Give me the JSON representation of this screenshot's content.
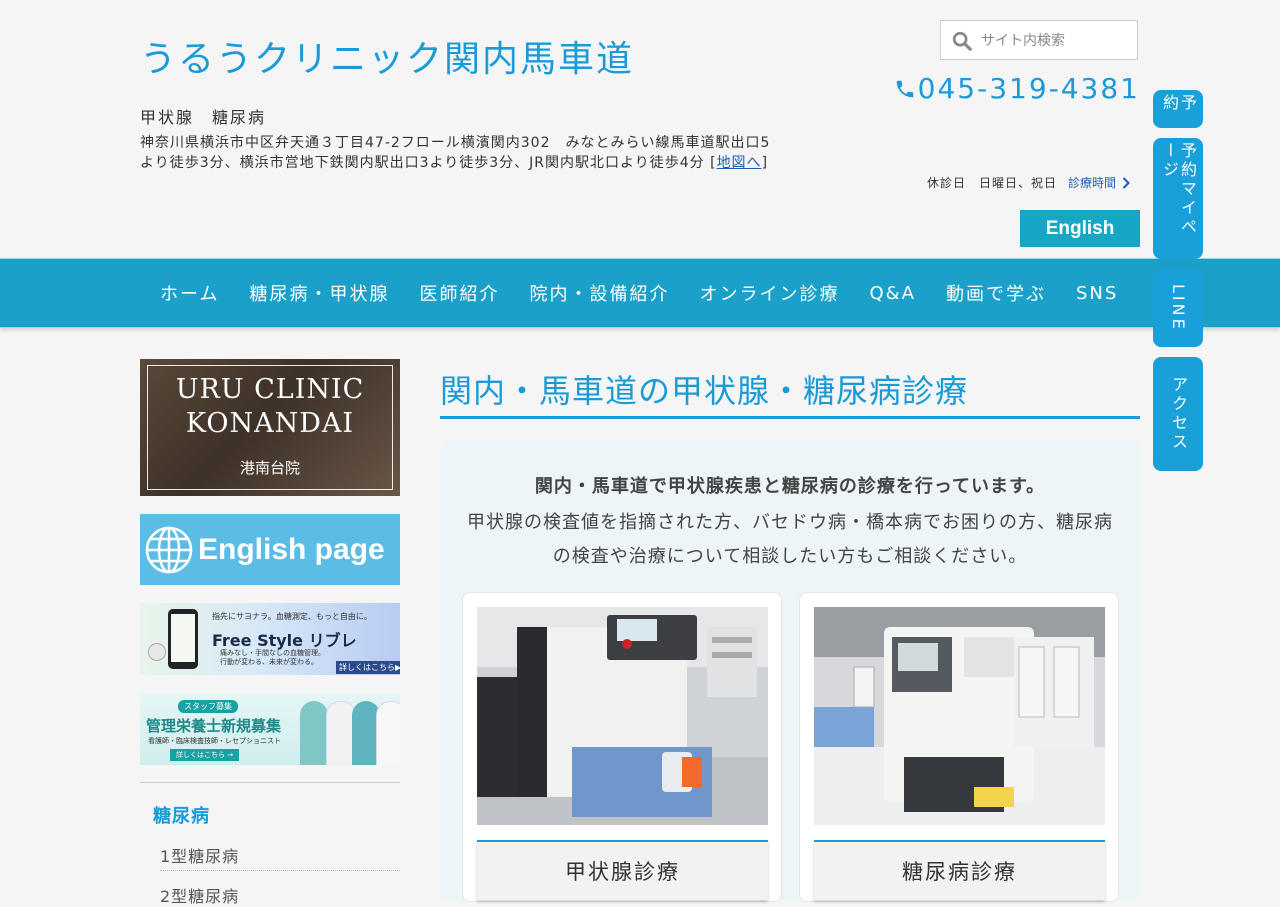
{
  "header": {
    "site_title": "うるうクリニック関内馬車道",
    "tagline": "甲状腺　糖尿病",
    "address": "神奈川県横浜市中区弁天通３丁目47-2フロール横濱関内302　みなとみらい線馬車道駅出口5より徒歩3分、横浜市営地下鉄関内駅出口3より徒歩3分、JR関内駅北口より徒歩4分 [",
    "map_link": "地図へ",
    "address_close": "]",
    "search_placeholder": "サイト内検索",
    "phone": "045-319-4381",
    "closed_days": "休診日　日曜日、祝日",
    "hours_link": "診療時間",
    "english_button": "English"
  },
  "nav": {
    "items": [
      "ホーム",
      "糖尿病・甲状腺",
      "医師紹介",
      "院内・設備紹介",
      "オンライン診療",
      "Q&A",
      "動画で学ぶ",
      "SNS"
    ]
  },
  "float_buttons": [
    "予約",
    "予約マイページ",
    "LINE",
    "アクセス"
  ],
  "sidebar": {
    "banner_konan_line1": "URU CLINIC",
    "banner_konan_line2": "KONANDAI",
    "banner_konan_sub": "港南台院",
    "banner_english": "English page",
    "banner_libre_top": "指先にサヨナラ。血糖測定、もっと自由に。",
    "banner_libre_main": "Free Style リブレ",
    "banner_libre_sub1": "痛みなし・手間なしの血糖管理。",
    "banner_libre_sub2": "行動が変わる、未来が変わる。",
    "banner_libre_more": "詳しくはこちら▶",
    "banner_staff_badge": "スタッフ募集",
    "banner_staff_main": "管理栄養士新規募集",
    "banner_staff_sub": "看護師・臨床検査技師・レセプショニスト",
    "banner_staff_more": "詳しくはこちら →",
    "heading": "糖尿病",
    "items": [
      "1型糖尿病",
      "2型糖尿病"
    ]
  },
  "main": {
    "title": "関内・馬車道の甲状腺・糖尿病診療",
    "lead": "関内・馬車道で甲状腺疾患と糖尿病の診療を行っています。",
    "text": "甲状腺の検査値を指摘された方、バセドウ病・橋本病でお困りの方、糖尿病の検査や治療について相談したい方もご相談ください。",
    "cards": [
      {
        "label": "甲状腺診療"
      },
      {
        "label": "糖尿病診療"
      }
    ]
  },
  "colors": {
    "accent": "#1a9bd7",
    "nav_bg": "#1aa0c9",
    "float_bg": "#1aa0d8",
    "english_btn": "#16a7c7"
  }
}
